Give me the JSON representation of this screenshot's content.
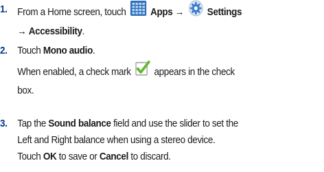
{
  "steps": [
    {
      "number": "1.",
      "line1_pre": "From a Home screen, touch",
      "apps_label": "Apps",
      "arrow": "→",
      "settings_label": "Settings",
      "line2_arrow": "→",
      "line2_bold": "Accessibility",
      "line2_post": ".",
      "icons": [
        "apps-grid-icon",
        "settings-gear-icon"
      ]
    },
    {
      "number": "2.",
      "line1_pre": "Touch",
      "line1_bold": "Mono audio",
      "line1_post": ".",
      "line2_pre": "When enabled, a check mark",
      "line2_post": "appears in the check",
      "line3": "box.",
      "icons": [
        "checkmark-box-icon"
      ]
    },
    {
      "number": "3.",
      "line1_pre": "Tap the",
      "line1_bold": "Sound balance",
      "line1_post": "field and use the slider to set the",
      "line2": "Left and Right balance when using a stereo device.",
      "line3_pre": "Touch",
      "line3_bold1": "OK",
      "line3_mid": "to save or",
      "line3_bold2": "Cancel",
      "line3_post": "to discard."
    }
  ],
  "colors": {
    "number": "#003b8a",
    "text": "#1a1a1a",
    "apps_icon": "#3d7fc9",
    "settings_icon": "#4a8ad0",
    "check_box": "#6abf3a"
  }
}
